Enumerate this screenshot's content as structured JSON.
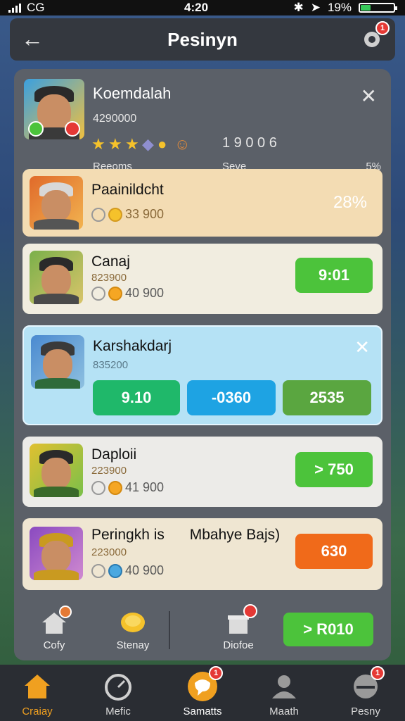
{
  "status": {
    "carrier": "CG",
    "time": "4:20",
    "battery": "19%"
  },
  "header": {
    "title": "Pesinyn",
    "notif_count": "1"
  },
  "profile": {
    "name": "Koemdalah",
    "score": "4290000",
    "chips": "1   9 0 0 6",
    "label_left": "Reeoms",
    "label_mid": "Seve",
    "label_right": "5%"
  },
  "cards": [
    {
      "name": "Paainildcht",
      "stat": "33 900",
      "right": "28%"
    },
    {
      "name": "Canaj",
      "sub": "823900",
      "stat": "40 900",
      "button": "9:01"
    },
    {
      "name": "Karshakdarj",
      "sub": "835200",
      "b1": "9.10",
      "b2": "-0360",
      "b3": "2535"
    },
    {
      "name": "Daploii",
      "sub": "223900",
      "stat": "41 900",
      "button": "> 750"
    },
    {
      "name": "Peringkh is",
      "extra": "Mbahye Bajs)",
      "sub": "223000",
      "stat": "40 900",
      "button": "630"
    }
  ],
  "actions": {
    "a1": "Cofy",
    "a2": "Stenay",
    "a3": "Diofoe",
    "cta": "> R010"
  },
  "tabs": [
    {
      "label": "Craiay"
    },
    {
      "label": "Mefic"
    },
    {
      "label": "Samatts"
    },
    {
      "label": "Maath"
    },
    {
      "label": "Pesny"
    }
  ],
  "colors": {
    "panel": "#5b6068",
    "accent_green": "#4cc33b",
    "accent_blue": "#1ea3e3",
    "accent_orange": "#f06a1a"
  }
}
